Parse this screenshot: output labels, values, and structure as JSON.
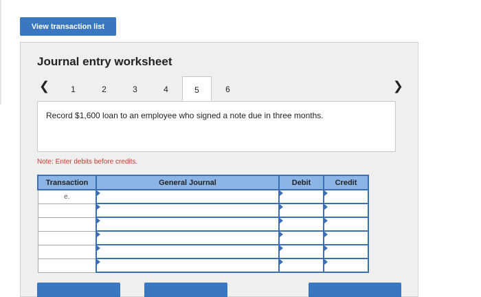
{
  "toolbar": {
    "view_label": "View transaction list"
  },
  "worksheet": {
    "title": "Journal entry worksheet",
    "tabs": [
      "1",
      "2",
      "3",
      "4",
      "5",
      "6"
    ],
    "active_tab": "5",
    "prompt": "Record $1,600 loan to an employee who signed a note due in three months.",
    "note": "Note: Enter debits before credits."
  },
  "table": {
    "headers": {
      "transaction": "Transaction",
      "journal": "General Journal",
      "debit": "Debit",
      "credit": "Credit"
    },
    "rows": [
      {
        "transaction": "e.",
        "account": "",
        "debit": "",
        "credit": ""
      },
      {
        "transaction": "",
        "account": "",
        "debit": "",
        "credit": ""
      },
      {
        "transaction": "",
        "account": "",
        "debit": "",
        "credit": ""
      },
      {
        "transaction": "",
        "account": "",
        "debit": "",
        "credit": ""
      },
      {
        "transaction": "",
        "account": "",
        "debit": "",
        "credit": ""
      },
      {
        "transaction": "",
        "account": "",
        "debit": "",
        "credit": ""
      }
    ]
  },
  "colors": {
    "accent": "#3a77c1",
    "header_fill": "#8bb4e7",
    "note": "#c0392b"
  }
}
